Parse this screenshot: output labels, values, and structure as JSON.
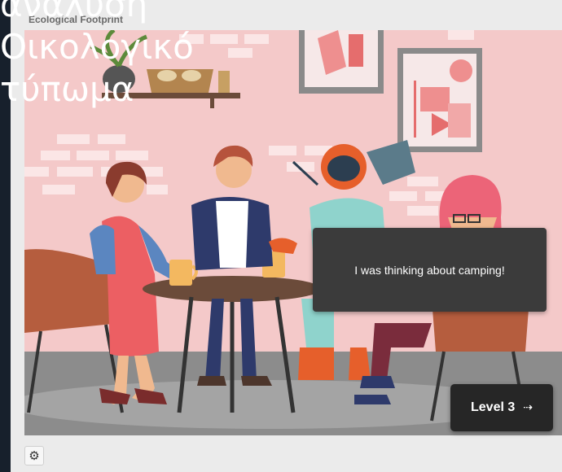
{
  "app": {
    "title": "Ecological Footprint"
  },
  "overlay": {
    "lines": [
      "ανάλυση",
      "Οικολογικό",
      "τύπωμα"
    ]
  },
  "dialog": {
    "text": "I was thinking about camping!"
  },
  "level_button": {
    "label": "Level 3",
    "icon": "arrow-right-icon",
    "arrow_glyph": "⇢"
  },
  "settings": {
    "icon": "gear-icon",
    "glyph": "⚙"
  },
  "colors": {
    "wall": "#f4c9c9",
    "floor": "#8c8c8c",
    "dialog_bg": "#3b3b3b",
    "button_bg": "#262626"
  }
}
